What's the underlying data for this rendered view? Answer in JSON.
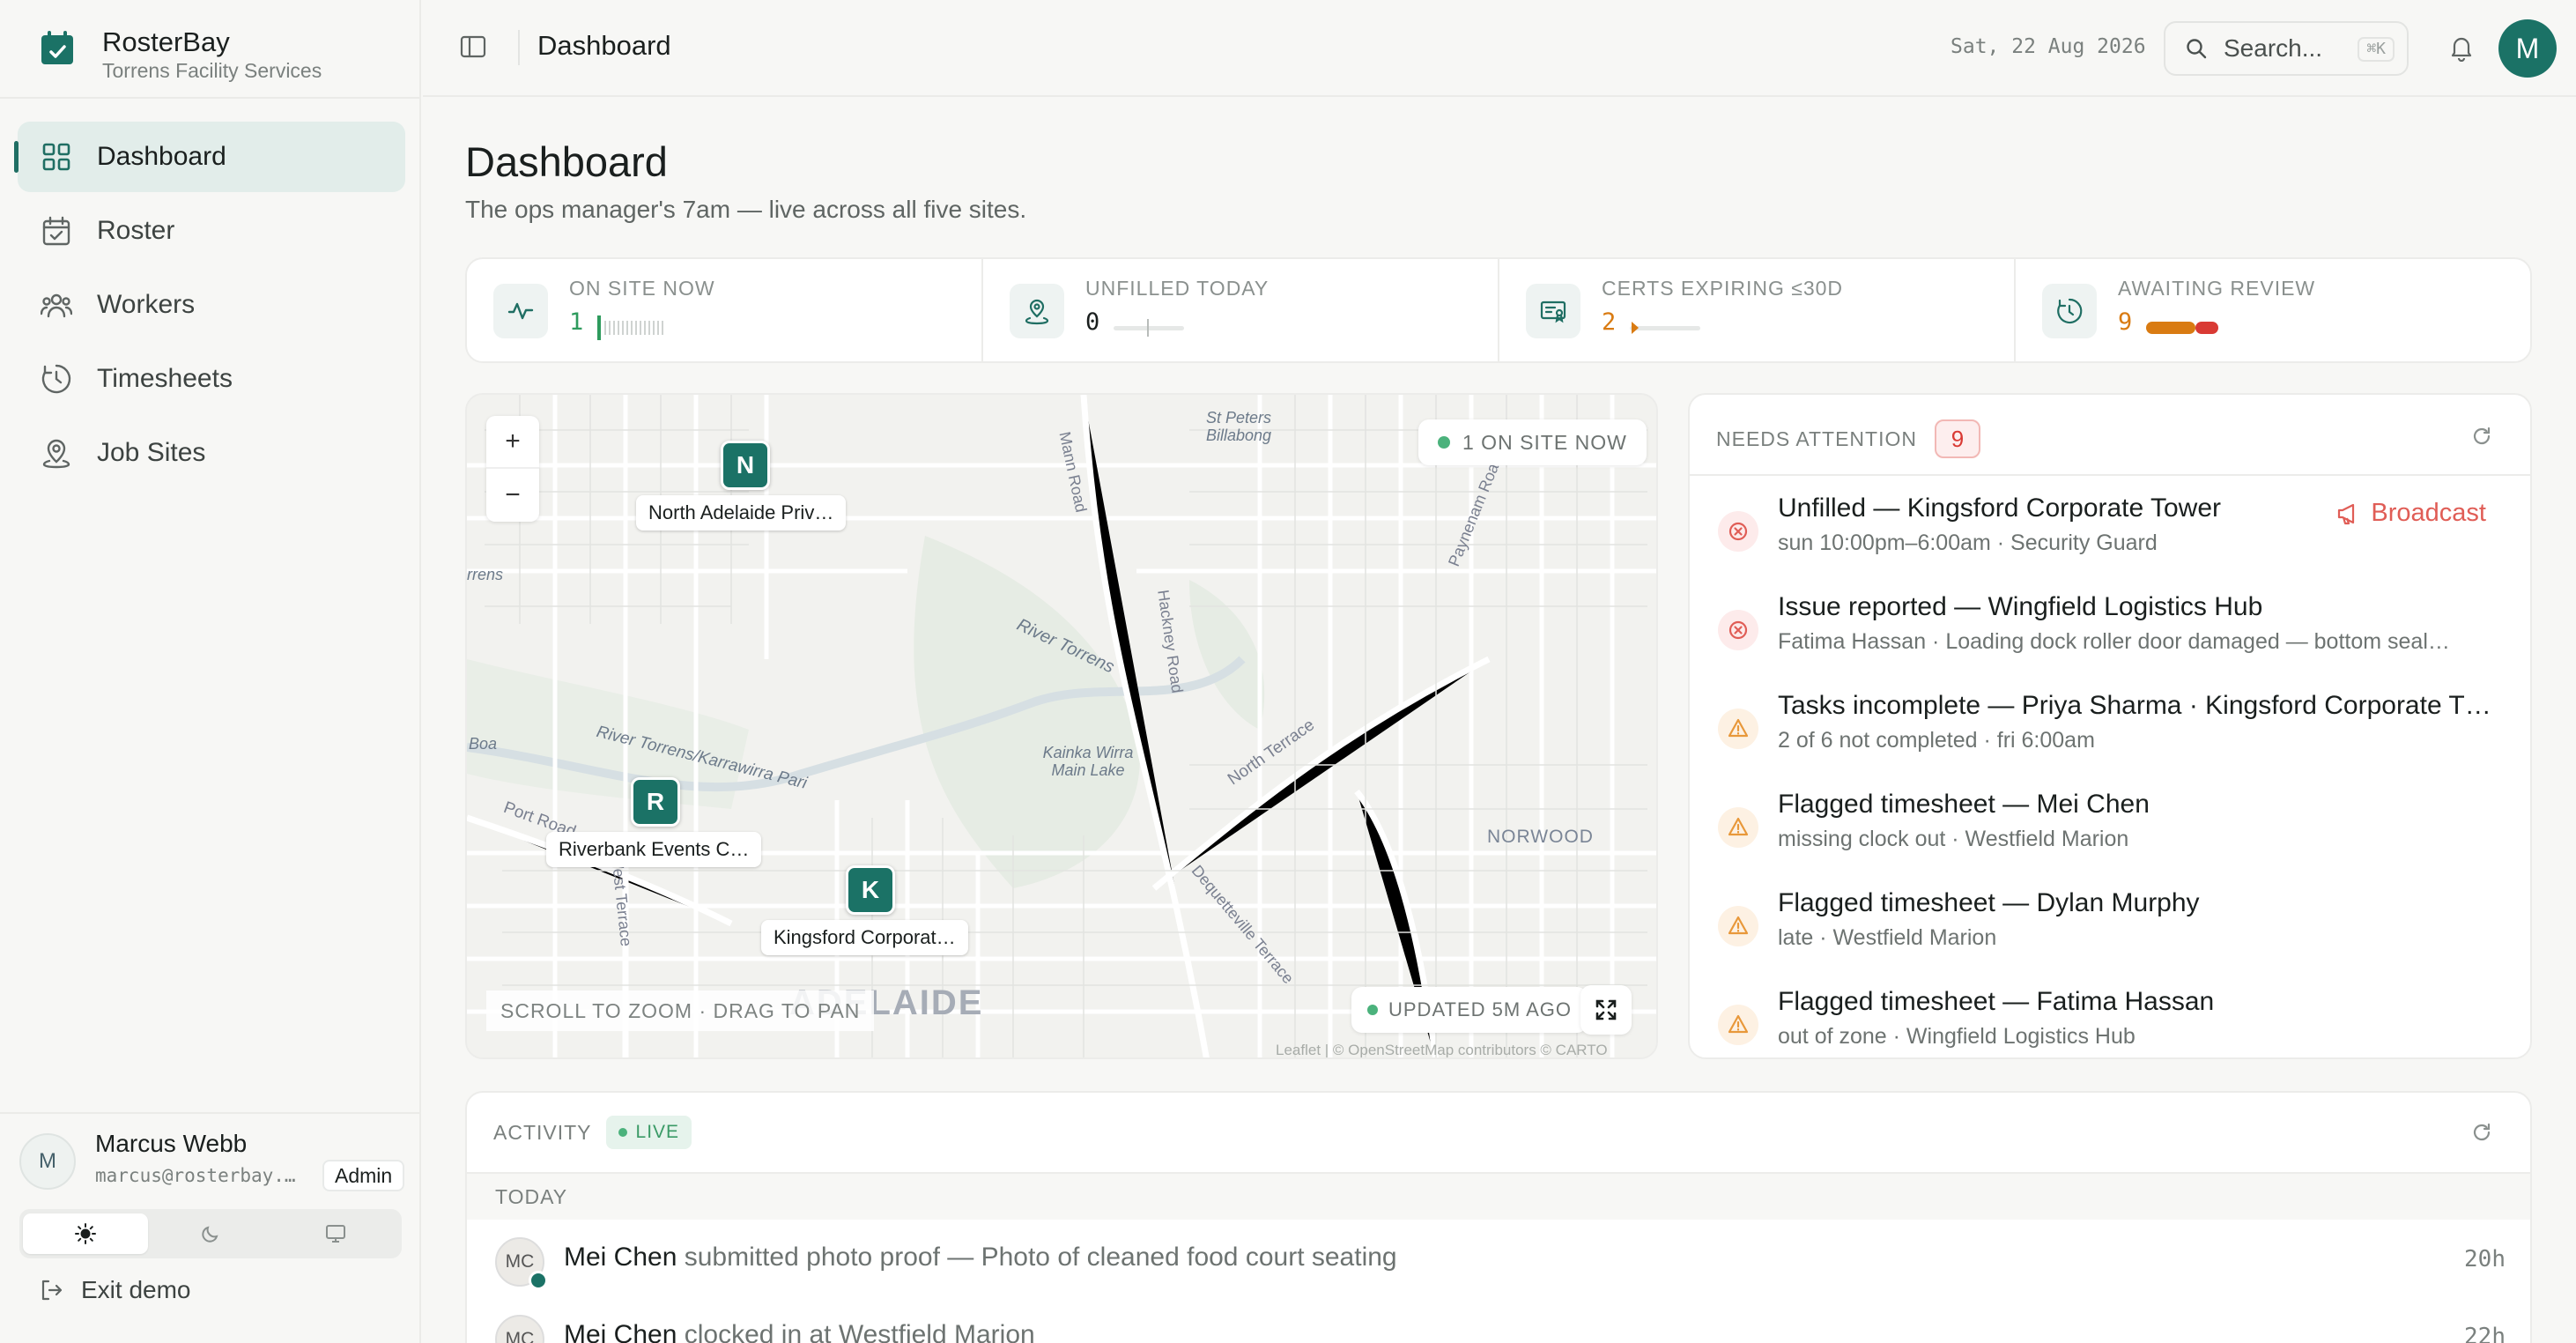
{
  "app": {
    "name": "RosterBay",
    "org": "Torrens Facility Services"
  },
  "nav": [
    {
      "label": "Dashboard",
      "icon": "grid-icon",
      "active": true
    },
    {
      "label": "Roster",
      "icon": "calendar-check-icon"
    },
    {
      "label": "Workers",
      "icon": "users-icon"
    },
    {
      "label": "Timesheets",
      "icon": "clock-icon"
    },
    {
      "label": "Job Sites",
      "icon": "map-pin-icon"
    }
  ],
  "user": {
    "initial": "M",
    "name": "Marcus Webb",
    "email": "marcus@rosterbay.…",
    "role": "Admin"
  },
  "theme": {
    "options": [
      "sun-icon",
      "moon-icon",
      "monitor-icon"
    ],
    "selected": "light"
  },
  "exit_label": "Exit demo",
  "topbar": {
    "title": "Dashboard",
    "date": "Sat, 22 Aug 2026",
    "search_placeholder": "Search...",
    "shortcut": "⌘K",
    "avatar": "M"
  },
  "page": {
    "title": "Dashboard",
    "subtitle": "The ops manager's 7am — live across all five sites."
  },
  "stats": [
    {
      "label": "ON SITE NOW",
      "value": "1",
      "color": "#2e9b5d",
      "icon": "activity-icon"
    },
    {
      "label": "UNFILLED TODAY",
      "value": "0",
      "color": "#1a1f1e",
      "icon": "pin-user-icon"
    },
    {
      "label": "CERTS EXPIRING ≤30D",
      "value": "2",
      "color": "#d97b12",
      "icon": "certificate-icon"
    },
    {
      "label": "AWAITING REVIEW",
      "value": "9",
      "color": "#d97b12",
      "icon": "clock-review-icon"
    }
  ],
  "map": {
    "onsite_label": "1 ON SITE NOW",
    "updated_label": "UPDATED 5M AGO",
    "hint": "SCROLL TO ZOOM · DRAG TO PAN",
    "attribution": "Leaflet | © OpenStreetMap contributors © CARTO",
    "zoom_in": "+",
    "zoom_out": "−",
    "markers": [
      {
        "letter": "N",
        "label": "North Adelaide Priv…"
      },
      {
        "letter": "R",
        "label": "Riverbank Events C…"
      },
      {
        "letter": "K",
        "label": "Kingsford Corporat…"
      }
    ],
    "place_labels": [
      "St Peters Billabong",
      "Mann Road",
      "Paynenam Road",
      "River Torrens",
      "Hackney Road",
      "North Terrace",
      "Kainka Wirra Main Lake",
      "River Torrens/Karrawirra Pari",
      "Port Road",
      "West Terrace",
      "Dequetteville Terrace",
      "NORWOOD",
      "ADELAIDE",
      "Boa",
      "rrens"
    ]
  },
  "attention": {
    "title": "NEEDS ATTENTION",
    "count": "9",
    "items": [
      {
        "type": "error",
        "title": "Unfilled — Kingsford Corporate Tower",
        "sub": "sun 10:00pm–6:00am · Security Guard",
        "action": "Broadcast"
      },
      {
        "type": "error",
        "title": "Issue reported — Wingfield Logistics Hub",
        "sub": "Fatima Hassan · Loading dock roller door damaged — bottom seal…"
      },
      {
        "type": "warning",
        "title": "Tasks incomplete — Priya Sharma · Kingsford Corporate T…",
        "sub": "2 of 6 not completed · fri 6:00am"
      },
      {
        "type": "warning",
        "title": "Flagged timesheet — Mei Chen",
        "sub": "missing clock out · Westfield Marion"
      },
      {
        "type": "warning",
        "title": "Flagged timesheet — Dylan Murphy",
        "sub": "late · Westfield Marion"
      },
      {
        "type": "warning",
        "title": "Flagged timesheet — Fatima Hassan",
        "sub": "out of zone · Wingfield Logistics Hub"
      }
    ]
  },
  "activity": {
    "title": "ACTIVITY",
    "live": "LIVE",
    "day": "TODAY",
    "items": [
      {
        "initials": "MC",
        "actor": "Mei Chen",
        "text": " submitted photo proof — Photo of cleaned food court seating",
        "time": "20h"
      },
      {
        "initials": "MC",
        "actor": "Mei Chen",
        "text": " clocked in at Westfield Marion",
        "time": "22h"
      }
    ]
  },
  "colors": {
    "accent": "#1b7266",
    "error": "#e05d56",
    "warning": "#e8983a",
    "live": "#4bb27c"
  }
}
